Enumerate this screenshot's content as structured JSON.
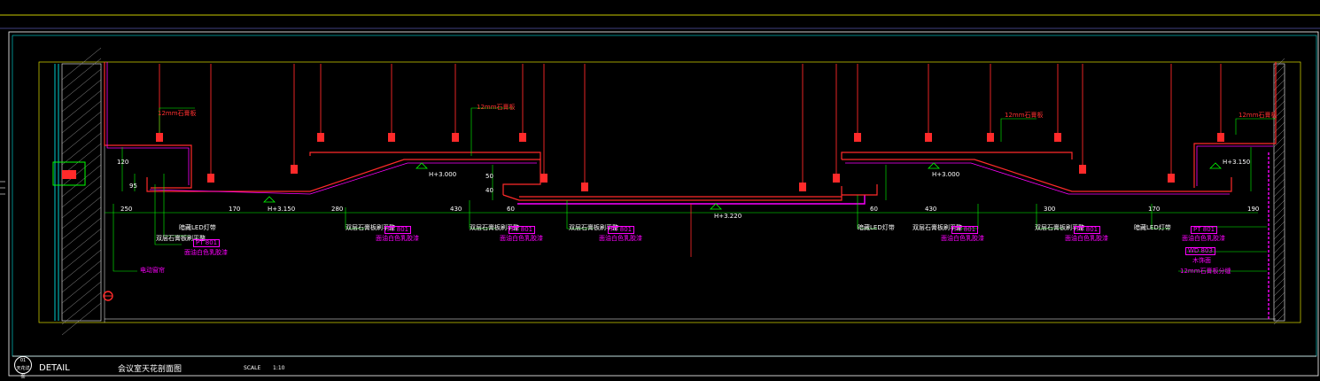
{
  "title_block": {
    "number": "01",
    "sheet": "天花详图",
    "detail": "DETAIL",
    "name": "会议室天花剖面图",
    "scale_label": "SCALE",
    "scale_value": "1:10"
  },
  "annotations": {
    "gypsum_left": "12mm石膏板",
    "gypsum_mid_left": "12mm石膏板",
    "gypsum_mid_right": "12mm石膏板",
    "gypsum_right": "12mm石膏板",
    "level_left": "H+3.150",
    "level_mid_left": "H+3.000",
    "level_center": "H+3.220",
    "level_mid_right": "H+3.000",
    "level_right": "H+3.150",
    "led_left": "暗藏LED灯带",
    "led_mid": "暗藏LED灯带",
    "led_right": "暗藏LED灯带",
    "framing_1": "双层石膏板刷平整",
    "framing_2": "双层石膏板刷平整",
    "framing_3": "双层石膏板刷平整",
    "framing_4": "双层石膏板刷平整",
    "framing_5": "双层石膏板刷平整",
    "framing_6": "双层石膏板刷平整",
    "tag_pt": "PT",
    "tag_code": "801",
    "tag_wd": "WD",
    "tag_wd_code": "803",
    "paint_1": "面油白色乳胶漆",
    "paint_2": "面油白色乳胶漆",
    "paint_3": "面油白色乳胶漆",
    "paint_4": "面油白色乳胶漆",
    "paint_5": "面油白色乳胶漆",
    "paint_6": "面油白色乳胶漆",
    "paint_7": "面油白色乳胶漆",
    "wood_finish": "木饰面",
    "curtain": "电动窗帘",
    "gypsum_bottom": "12mm石膏板分缝"
  },
  "dimensions": {
    "d250": "250",
    "d170": "170",
    "d280": "280",
    "d430": "430",
    "d60": "60",
    "d60b": "60",
    "d430b": "430",
    "d300": "300",
    "d170b": "170",
    "d190": "190",
    "v120": "120",
    "v95": "95",
    "v50": "50",
    "v40": "40"
  },
  "colors": {
    "background": "#000000",
    "frame": "#00ffff",
    "border": "#ffff00",
    "structure": "#ff2a2a",
    "finish": "#ff00ff",
    "leader": "#00ff00",
    "text": "#ffffff"
  }
}
